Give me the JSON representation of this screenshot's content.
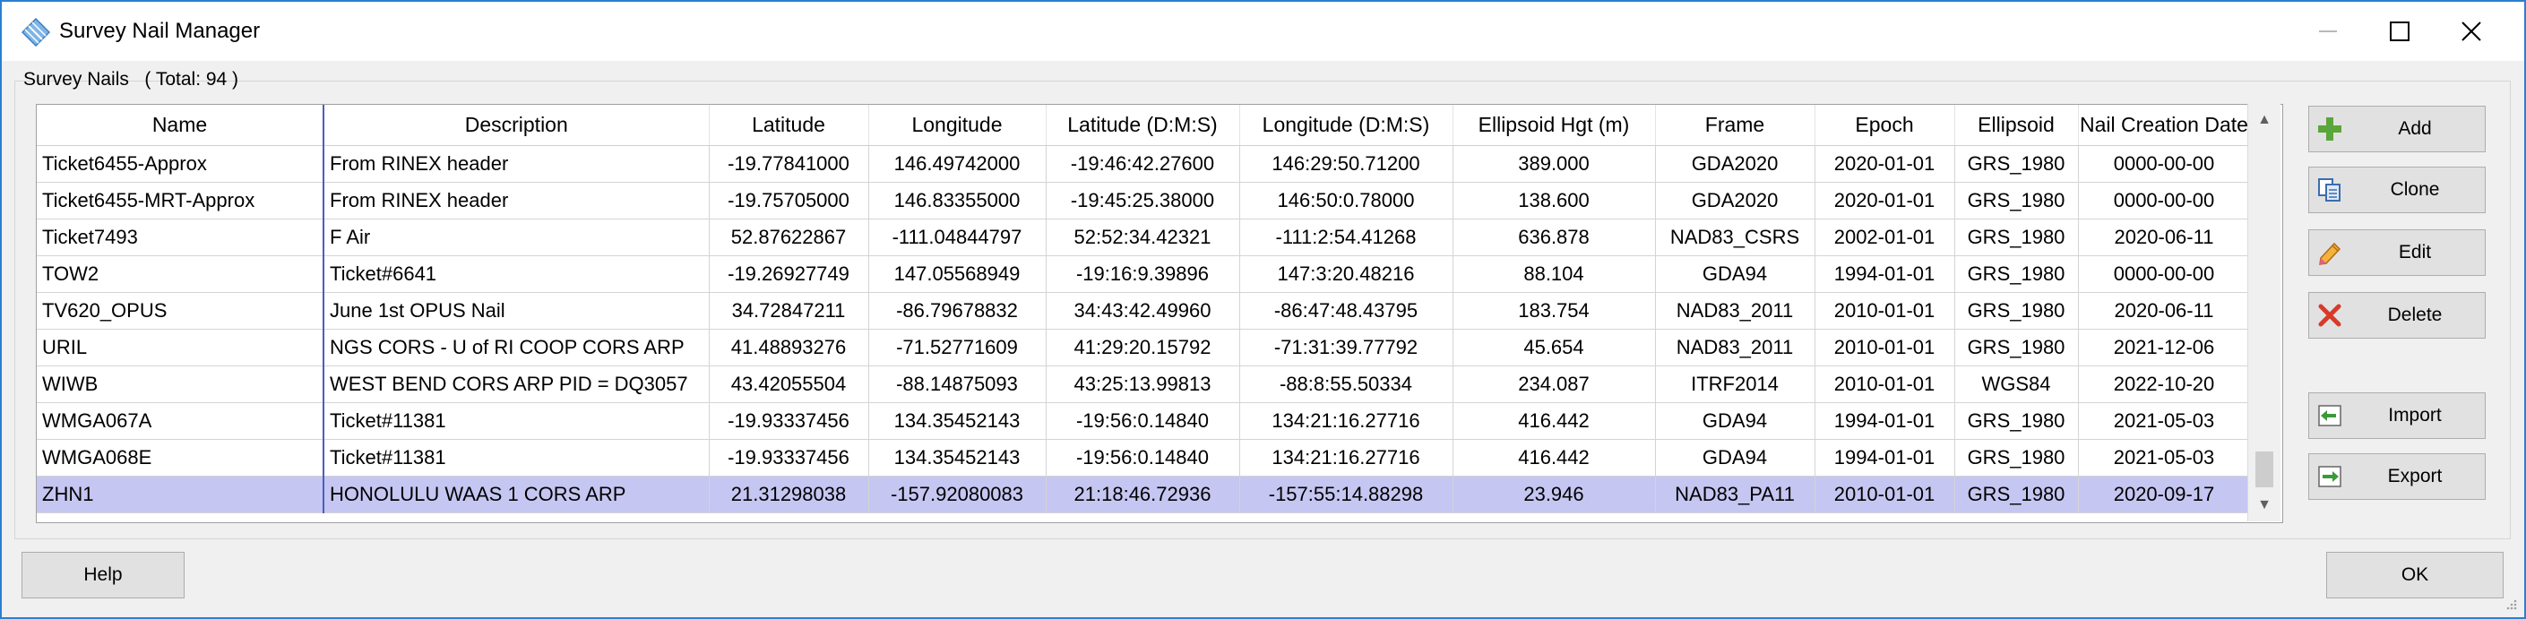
{
  "window": {
    "title": "Survey Nail Manager"
  },
  "group": {
    "label": "Survey Nails",
    "total": "( Total: 94 )"
  },
  "table": {
    "columns": [
      "Name",
      "Description",
      "Latitude",
      "Longitude",
      "Latitude (D:M:S)",
      "Longitude (D:M:S)",
      "Ellipsoid Hgt (m)",
      "Frame",
      "Epoch",
      "Ellipsoid",
      "Nail Creation Date"
    ],
    "rows": [
      [
        "Ticket6455-Approx",
        "From RINEX header",
        "-19.77841000",
        "146.49742000",
        "-19:46:42.27600",
        "146:29:50.71200",
        "389.000",
        "GDA2020",
        "2020-01-01",
        "GRS_1980",
        "0000-00-00"
      ],
      [
        "Ticket6455-MRT-Approx",
        "From RINEX header",
        "-19.75705000",
        "146.83355000",
        "-19:45:25.38000",
        "146:50:0.78000",
        "138.600",
        "GDA2020",
        "2020-01-01",
        "GRS_1980",
        "0000-00-00"
      ],
      [
        "Ticket7493",
        "F Air",
        "52.87622867",
        "-111.04844797",
        "52:52:34.42321",
        "-111:2:54.41268",
        "636.878",
        "NAD83_CSRS",
        "2002-01-01",
        "GRS_1980",
        "2020-06-11"
      ],
      [
        "TOW2",
        "Ticket#6641",
        "-19.26927749",
        "147.05568949",
        "-19:16:9.39896",
        "147:3:20.48216",
        "88.104",
        "GDA94",
        "1994-01-01",
        "GRS_1980",
        "0000-00-00"
      ],
      [
        "TV620_OPUS",
        "June 1st OPUS Nail",
        "34.72847211",
        "-86.79678832",
        "34:43:42.49960",
        "-86:47:48.43795",
        "183.754",
        "NAD83_2011",
        "2010-01-01",
        "GRS_1980",
        "2020-06-11"
      ],
      [
        "URIL",
        "NGS CORS - U of RI COOP CORS ARP",
        "41.48893276",
        "-71.52771609",
        "41:29:20.15792",
        "-71:31:39.77792",
        "45.654",
        "NAD83_2011",
        "2010-01-01",
        "GRS_1980",
        "2021-12-06"
      ],
      [
        "WIWB",
        "WEST BEND CORS ARP  PID = DQ3057",
        "43.42055504",
        "-88.14875093",
        "43:25:13.99813",
        "-88:8:55.50334",
        "234.087",
        "ITRF2014",
        "2010-01-01",
        "WGS84",
        "2022-10-20"
      ],
      [
        "WMGA067A",
        "Ticket#11381",
        "-19.93337456",
        "134.35452143",
        "-19:56:0.14840",
        "134:21:16.27716",
        "416.442",
        "GDA94",
        "1994-01-01",
        "GRS_1980",
        "2021-05-03"
      ],
      [
        "WMGA068E",
        "Ticket#11381",
        "-19.93337456",
        "134.35452143",
        "-19:56:0.14840",
        "134:21:16.27716",
        "416.442",
        "GDA94",
        "1994-01-01",
        "GRS_1980",
        "2021-05-03"
      ],
      [
        "ZHN1",
        "HONOLULU WAAS 1 CORS ARP",
        "21.31298038",
        "-157.92080083",
        "21:18:46.72936",
        "-157:55:14.88298",
        "23.946",
        "NAD83_PA11",
        "2010-01-01",
        "GRS_1980",
        "2020-09-17"
      ]
    ],
    "selected_row": 9
  },
  "buttons": {
    "add": "Add",
    "clone": "Clone",
    "edit": "Edit",
    "delete": "Delete",
    "import": "Import",
    "export": "Export",
    "help": "Help",
    "ok": "OK"
  },
  "colors": {
    "selection": "#c6c6f2",
    "window_border": "#2a7fd4",
    "add_icon": "#5aa63a",
    "delete_icon": "#d83a2a"
  }
}
